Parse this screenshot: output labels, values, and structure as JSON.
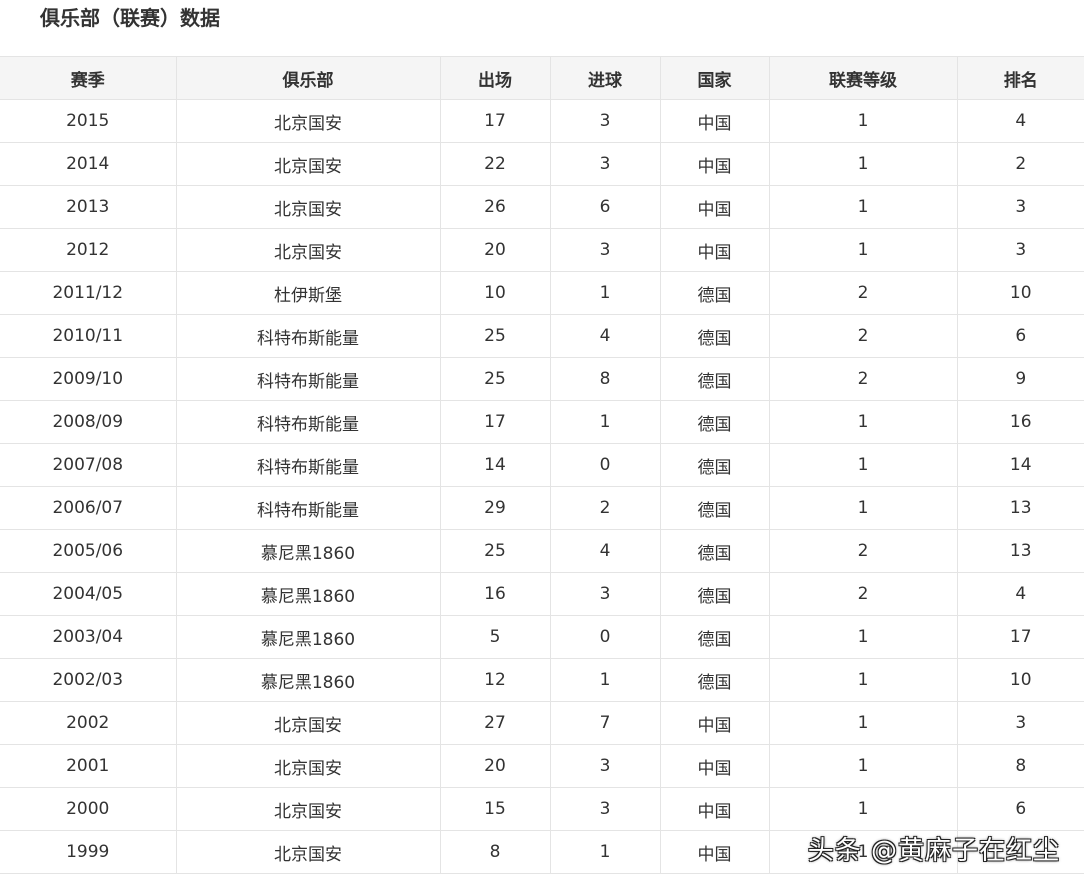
{
  "title": "俱乐部（联赛）数据",
  "table": {
    "headers": [
      "赛季",
      "俱乐部",
      "出场",
      "进球",
      "国家",
      "联赛等级",
      "排名"
    ],
    "rows": [
      [
        "2015",
        "北京国安",
        "17",
        "3",
        "中国",
        "1",
        "4"
      ],
      [
        "2014",
        "北京国安",
        "22",
        "3",
        "中国",
        "1",
        "2"
      ],
      [
        "2013",
        "北京国安",
        "26",
        "6",
        "中国",
        "1",
        "3"
      ],
      [
        "2012",
        "北京国安",
        "20",
        "3",
        "中国",
        "1",
        "3"
      ],
      [
        "2011/12",
        "杜伊斯堡",
        "10",
        "1",
        "德国",
        "2",
        "10"
      ],
      [
        "2010/11",
        "科特布斯能量",
        "25",
        "4",
        "德国",
        "2",
        "6"
      ],
      [
        "2009/10",
        "科特布斯能量",
        "25",
        "8",
        "德国",
        "2",
        "9"
      ],
      [
        "2008/09",
        "科特布斯能量",
        "17",
        "1",
        "德国",
        "1",
        "16"
      ],
      [
        "2007/08",
        "科特布斯能量",
        "14",
        "0",
        "德国",
        "1",
        "14"
      ],
      [
        "2006/07",
        "科特布斯能量",
        "29",
        "2",
        "德国",
        "1",
        "13"
      ],
      [
        "2005/06",
        "慕尼黑1860",
        "25",
        "4",
        "德国",
        "2",
        "13"
      ],
      [
        "2004/05",
        "慕尼黑1860",
        "16",
        "3",
        "德国",
        "2",
        "4"
      ],
      [
        "2003/04",
        "慕尼黑1860",
        "5",
        "0",
        "德国",
        "1",
        "17"
      ],
      [
        "2002/03",
        "慕尼黑1860",
        "12",
        "1",
        "德国",
        "1",
        "10"
      ],
      [
        "2002",
        "北京国安",
        "27",
        "7",
        "中国",
        "1",
        "3"
      ],
      [
        "2001",
        "北京国安",
        "20",
        "3",
        "中国",
        "1",
        "8"
      ],
      [
        "2000",
        "北京国安",
        "15",
        "3",
        "中国",
        "1",
        "6"
      ],
      [
        "1999",
        "北京国安",
        "8",
        "1",
        "中国",
        "1",
        "4"
      ]
    ]
  },
  "watermark": "头条 @黄麻子在红尘"
}
